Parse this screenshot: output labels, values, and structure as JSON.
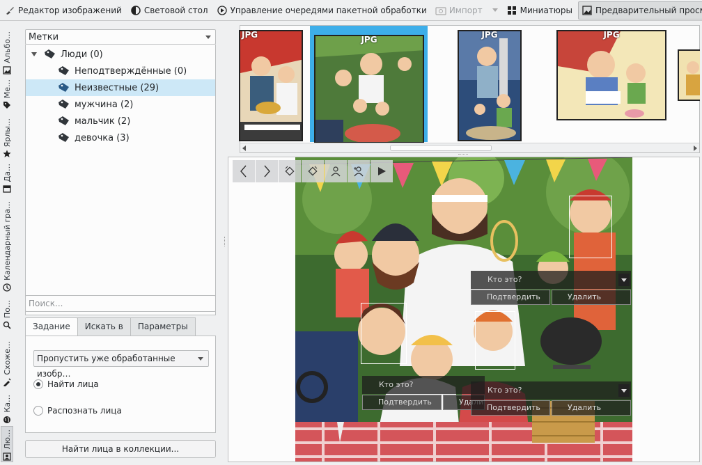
{
  "toolbar": {
    "items": [
      {
        "label": "Редактор изображений",
        "icon": "paintbrush-icon",
        "state": "normal"
      },
      {
        "label": "Световой стол",
        "icon": "contrast-icon",
        "state": "normal"
      },
      {
        "label": "Управление очередями пакетной обработки",
        "icon": "batch-queue-icon",
        "state": "normal"
      },
      {
        "label": "Импорт",
        "icon": "camera-icon",
        "state": "disabled"
      },
      {
        "label": "Миниатюры",
        "icon": "grid-icon",
        "state": "normal"
      },
      {
        "label": "Предварительный просмотр",
        "icon": "image-preview-icon",
        "state": "active"
      }
    ]
  },
  "side_tabs": [
    {
      "label": "Альбо…",
      "icon": "album-icon"
    },
    {
      "label": "Ме…",
      "icon": "tag-icon"
    },
    {
      "label": "Ярлы…",
      "icon": "star-icon"
    },
    {
      "label": "Да…",
      "icon": "calendar-icon"
    },
    {
      "label": "Календарный гра…",
      "icon": "timeline-icon"
    },
    {
      "label": "По…",
      "icon": "search-icon"
    },
    {
      "label": "Схоже…",
      "icon": "fuzzy-icon"
    },
    {
      "label": "Ка…",
      "icon": "globe-icon"
    },
    {
      "label": "Лю…",
      "icon": "people-icon"
    }
  ],
  "tags_panel": {
    "combo_label": "Метки",
    "tree": [
      {
        "label": "Люди (0)",
        "level": 0
      },
      {
        "label": "Неподтверждённые (0)",
        "level": 1
      },
      {
        "label": "Неизвестные (29)",
        "level": 1,
        "selected": true
      },
      {
        "label": "мужчина (2)",
        "level": 1
      },
      {
        "label": "мальчик (2)",
        "level": 1
      },
      {
        "label": "девочка (3)",
        "level": 1
      }
    ],
    "search_placeholder": "Поиск..."
  },
  "settings_tabs": [
    "Задание",
    "Искать в",
    "Параметры"
  ],
  "task": {
    "select_value": "Пропустить уже обработанные изобр…",
    "options": [
      {
        "label": "Найти лица",
        "checked": true
      },
      {
        "label": "Распознать лица",
        "checked": false
      }
    ],
    "scan_button": "Найти лица в коллекции..."
  },
  "thumbnails": [
    {
      "format": "JPG",
      "selected": false
    },
    {
      "format": "JPG",
      "selected": true
    },
    {
      "format": "JPG",
      "selected": false
    },
    {
      "format": "JPG",
      "selected": false
    },
    {
      "format": "",
      "selected": false
    }
  ],
  "face_panels": {
    "who_is_this": "Кто это?",
    "confirm": "Подтвердить",
    "remove": "Удалить",
    "partial_remove": "Удали"
  },
  "colors": {
    "selection": "#3daee9",
    "tree_selection": "#cde8f7",
    "window_bg": "#eff0f1"
  }
}
